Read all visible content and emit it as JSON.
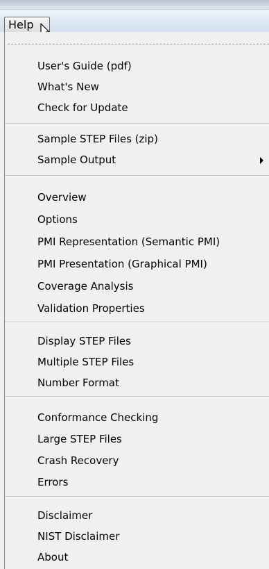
{
  "menubar": {
    "help_label": "Help"
  },
  "menu": {
    "items": [
      "User's Guide (pdf)",
      "What's New",
      "Check for Update",
      "Sample STEP Files (zip)",
      "Sample Output",
      "Overview",
      "Options",
      "PMI Representation (Semantic PMI)",
      "PMI Presentation (Graphical PMI)",
      "Coverage Analysis",
      "Validation Properties",
      "Display STEP Files",
      "Multiple STEP Files",
      "Number Format",
      "Conformance Checking",
      "Large STEP Files",
      "Crash Recovery",
      "Errors",
      "Disclaimer",
      "NIST Disclaimer",
      "About"
    ]
  },
  "icons": {
    "cursor": "mouse-pointer-icon",
    "submenu": "submenu-arrow-icon"
  }
}
